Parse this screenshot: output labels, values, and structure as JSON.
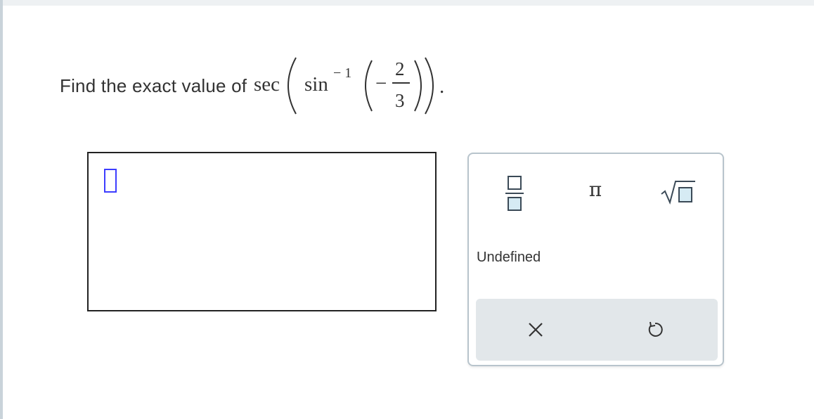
{
  "question": {
    "prompt": "Find the exact value of",
    "func_outer": "sec",
    "func_inner": "sin",
    "exponent": "− 1",
    "sign": "−",
    "numerator": "2",
    "denominator": "3",
    "period": "."
  },
  "answer": {
    "value": ""
  },
  "palette": {
    "fraction_icon": "fraction-icon",
    "pi_symbol": "π",
    "sqrt_icon": "square-root-icon",
    "undefined_label": "Undefined",
    "clear_icon": "close-icon",
    "undo_icon": "undo-icon"
  },
  "colors": {
    "cursor": "#3d3dff",
    "action_bar": "#e2e7ea",
    "palette_border": "#b8c4cc",
    "icon_fill": "#d6ebf4",
    "icon_stroke": "#3b4a57"
  }
}
